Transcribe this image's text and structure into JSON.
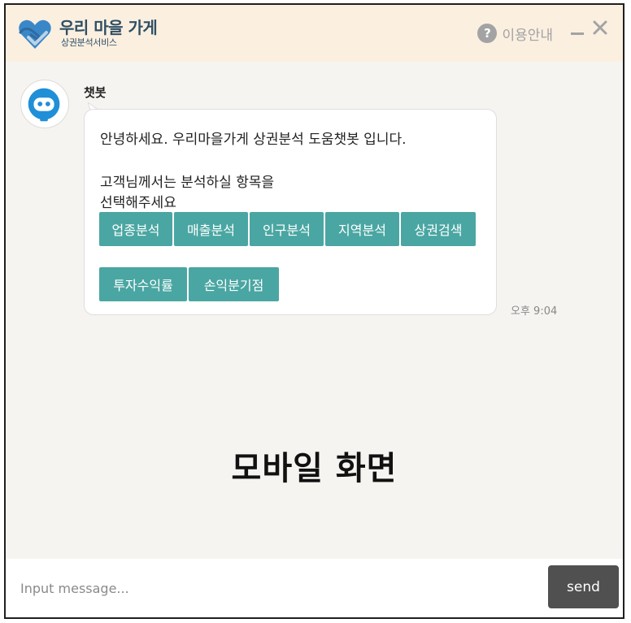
{
  "header": {
    "brand_title": "우리 마을 가게",
    "brand_subtitle": "상권분석서비스",
    "help_icon_glyph": "?",
    "help_label": "이용안내"
  },
  "chat": {
    "bot_name": "챗봇",
    "message_lines": [
      "안녕하세요. 우리마을가게 상권분석 도움챗봇 입니다.",
      "고객님께서는 분석하실 항목을",
      "선택해주세요"
    ],
    "options_row1": [
      "업종분석",
      "매출분석",
      "인구분석",
      "지역분석",
      "상권검색"
    ],
    "options_row2": [
      "투자수익률",
      "손익분기점"
    ],
    "timestamp": "오후 9:04"
  },
  "center_label": "모바일 화면",
  "footer": {
    "input_placeholder": "Input message...",
    "input_value": "",
    "send_label": "send"
  },
  "colors": {
    "header_bg": "#fbefe0",
    "chat_bg": "#f6f4f1",
    "option_bg": "#4aa6a2",
    "brand_text": "#2f4f64",
    "send_bg": "#505050"
  }
}
